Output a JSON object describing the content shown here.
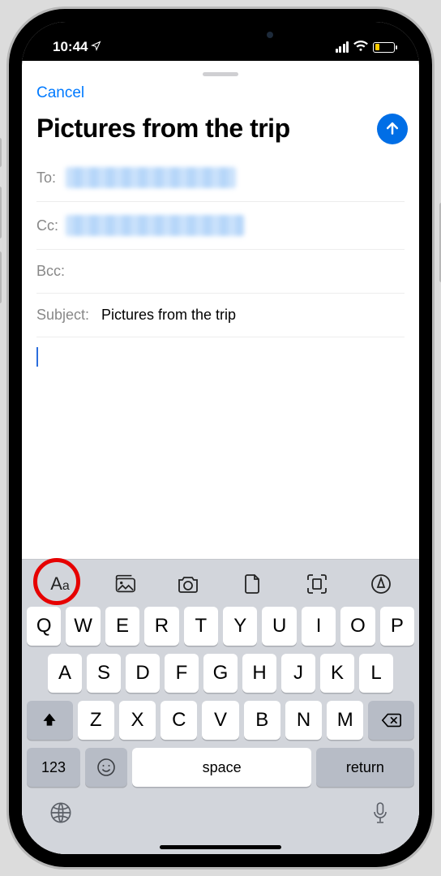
{
  "status": {
    "time": "10:44"
  },
  "header": {
    "cancel_label": "Cancel",
    "title": "Pictures from the trip"
  },
  "fields": {
    "to_label": "To:",
    "cc_label": "Cc:",
    "bcc_label": "Bcc:",
    "subject_label": "Subject:",
    "subject_value": "Pictures from the trip"
  },
  "toolbar_icons": [
    "font-format-icon",
    "gallery-icon",
    "camera-icon",
    "document-icon",
    "scan-icon",
    "markup-icon"
  ],
  "keyboard": {
    "row1": [
      "Q",
      "W",
      "E",
      "R",
      "T",
      "Y",
      "U",
      "I",
      "O",
      "P"
    ],
    "row2": [
      "A",
      "S",
      "D",
      "F",
      "G",
      "H",
      "J",
      "K",
      "L"
    ],
    "row3": [
      "Z",
      "X",
      "C",
      "V",
      "B",
      "N",
      "M"
    ],
    "num_label": "123",
    "space_label": "space",
    "return_label": "return"
  }
}
